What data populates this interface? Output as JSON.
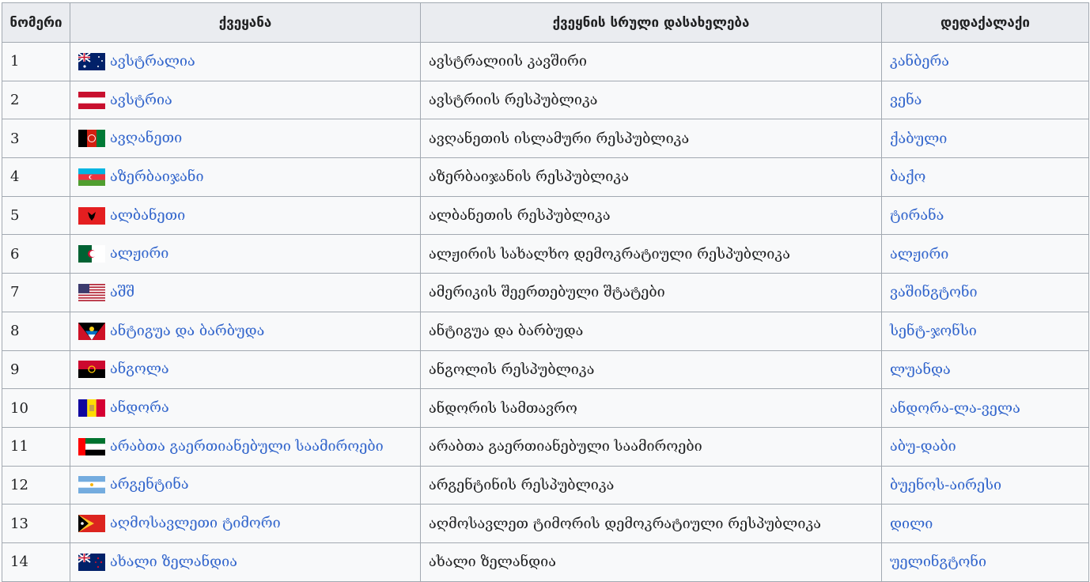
{
  "headers": [
    "ნომერი",
    "ქვეყანა",
    "ქვეყნის სრული დასახელება",
    "დედაქალაქი"
  ],
  "rows": [
    {
      "n": "1",
      "country": "ავსტრალია",
      "full": "ავსტრალიის კავშირი",
      "capital": "კანბერა",
      "flag": "australia"
    },
    {
      "n": "2",
      "country": "ავსტრია",
      "full": "ავსტრიის რესპუბლიკა",
      "capital": "ვენა",
      "flag": "austria"
    },
    {
      "n": "3",
      "country": "ავღანეთი",
      "full": "ავღანეთის ისლამური რესპუბლიკა",
      "capital": "ქაბული",
      "flag": "afghanistan"
    },
    {
      "n": "4",
      "country": "აზერბაიჯანი",
      "full": "აზერბაიჯანის რესპუბლიკა",
      "capital": "ბაქო",
      "flag": "azerbaijan"
    },
    {
      "n": "5",
      "country": "ალბანეთი",
      "full": "ალბანეთის რესპუბლიკა",
      "capital": "ტირანა",
      "flag": "albania"
    },
    {
      "n": "6",
      "country": "ალჟირი",
      "full": "ალჟირის სახალხო დემოკრატიული რესპუბლიკა",
      "capital": "ალჟირი",
      "flag": "algeria"
    },
    {
      "n": "7",
      "country": "აშშ",
      "full": "ამერიკის შეერთებული შტატები",
      "capital": "ვაშინგტონი",
      "flag": "usa"
    },
    {
      "n": "8",
      "country": "ანტიგუა და ბარბუდა",
      "full": "ანტიგუა და ბარბუდა",
      "capital": "სენტ-ჯონსი",
      "flag": "antigua"
    },
    {
      "n": "9",
      "country": "ანგოლა",
      "full": "ანგოლის რესპუბლიკა",
      "capital": "ლუანდა",
      "flag": "angola"
    },
    {
      "n": "10",
      "country": "ანდორა",
      "full": "ანდორის სამთავრო",
      "capital": "ანდორა-ლა-ველა",
      "flag": "andorra"
    },
    {
      "n": "11",
      "country": "არაბთა გაერთიანებული საამიროები",
      "full": "არაბთა გაერთიანებული საამიროები",
      "capital": "აბუ-დაბი",
      "flag": "uae"
    },
    {
      "n": "12",
      "country": "არგენტინა",
      "full": "არგენტინის რესპუბლიკა",
      "capital": "ბუენოს-აირესი",
      "flag": "argentina"
    },
    {
      "n": "13",
      "country": "აღმოსავლეთი ტიმორი",
      "full": "აღმოსავლეთ ტიმორის დემოკრატიული რესპუბლიკა",
      "capital": "დილი",
      "flag": "east-timor"
    },
    {
      "n": "14",
      "country": "ახალი ზელანდია",
      "full": "ახალი ზელანდია",
      "capital": "უელინგტონი",
      "flag": "new-zealand"
    }
  ]
}
